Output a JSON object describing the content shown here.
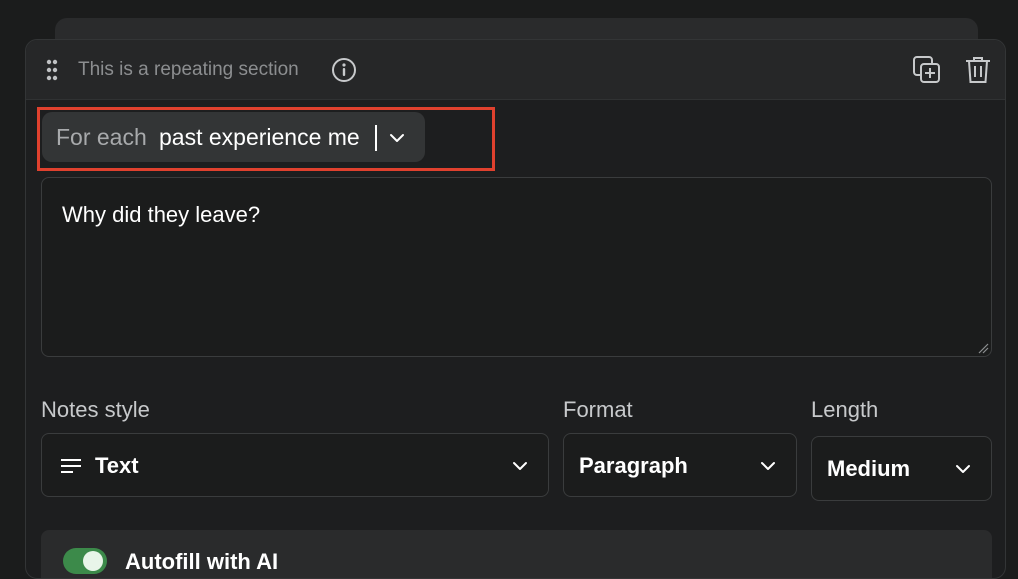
{
  "header": {
    "title": "This is a repeating section",
    "icons": [
      "drag-handle-icon",
      "info-icon",
      "duplicate-icon",
      "trash-icon"
    ]
  },
  "foreach": {
    "prefix": "For each",
    "value": "past experience me"
  },
  "question": {
    "text": "Why did they leave?"
  },
  "notes_style": {
    "label": "Notes style",
    "value": "Text",
    "icon": "text-lines-icon"
  },
  "format": {
    "label": "Format",
    "value": "Paragraph"
  },
  "length": {
    "label": "Length",
    "value": "Medium"
  },
  "autofill": {
    "label": "Autofill with AI",
    "enabled": true
  },
  "colors": {
    "background": "#1b1c1c",
    "highlight": "#e0412e",
    "toggle_on": "#3c8a4a"
  }
}
